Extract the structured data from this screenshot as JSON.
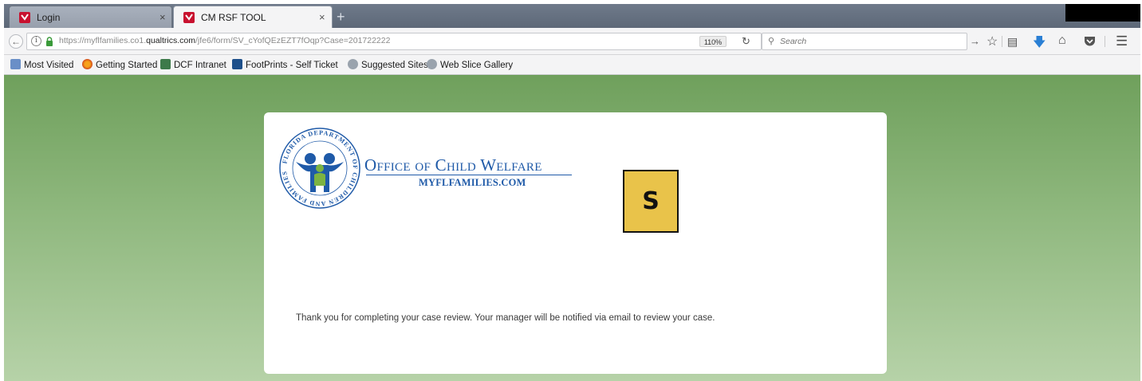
{
  "browser": {
    "tabs": [
      {
        "label": "Login",
        "close": "×"
      },
      {
        "label": "CM RSF TOOL",
        "close": "×"
      }
    ],
    "new_tab": "+",
    "url": {
      "prefix": "https://myflfamilies.co1.",
      "domain": "qualtrics.com",
      "suffix": "/jfe6/form/SV_cYofQEzEZT7fOqp?Case=201722222"
    },
    "zoom": "110%",
    "search_placeholder": "Search",
    "bookmarks": [
      "Most Visited",
      "Getting Started",
      "DCF Intranet",
      "FootPrints - Self Ticket",
      "Suggested Sites",
      "Web Slice Gallery"
    ]
  },
  "icons": {
    "back": "back-arrow-icon",
    "info": "info-icon",
    "lock": "lock-icon",
    "reload": "reload-icon",
    "search": "search-icon",
    "forward": "forward-arrow-icon",
    "star": "bookmark-star-icon",
    "reading": "reading-list-icon",
    "download": "download-icon",
    "home": "home-icon",
    "pocket": "pocket-icon",
    "menu": "hamburger-menu-icon"
  },
  "colors": {
    "accent_blue": "#1f5aa8",
    "badge_yellow": "#e9c34a",
    "page_green_top": "#6fa05c",
    "page_green_bottom": "#b6d2a8",
    "download_blue": "#2a7fd4"
  },
  "page": {
    "logo": {
      "seal_text": "FLORIDA DEPARTMENT OF CHILDREN AND FAMILIES",
      "office_title": "Office of Child Welfare",
      "office_url": "MYFLFAMILIES.COM"
    },
    "badge_letter": "S",
    "message": "Thank you for completing your case review. Your manager will be notified via email to review your case."
  }
}
